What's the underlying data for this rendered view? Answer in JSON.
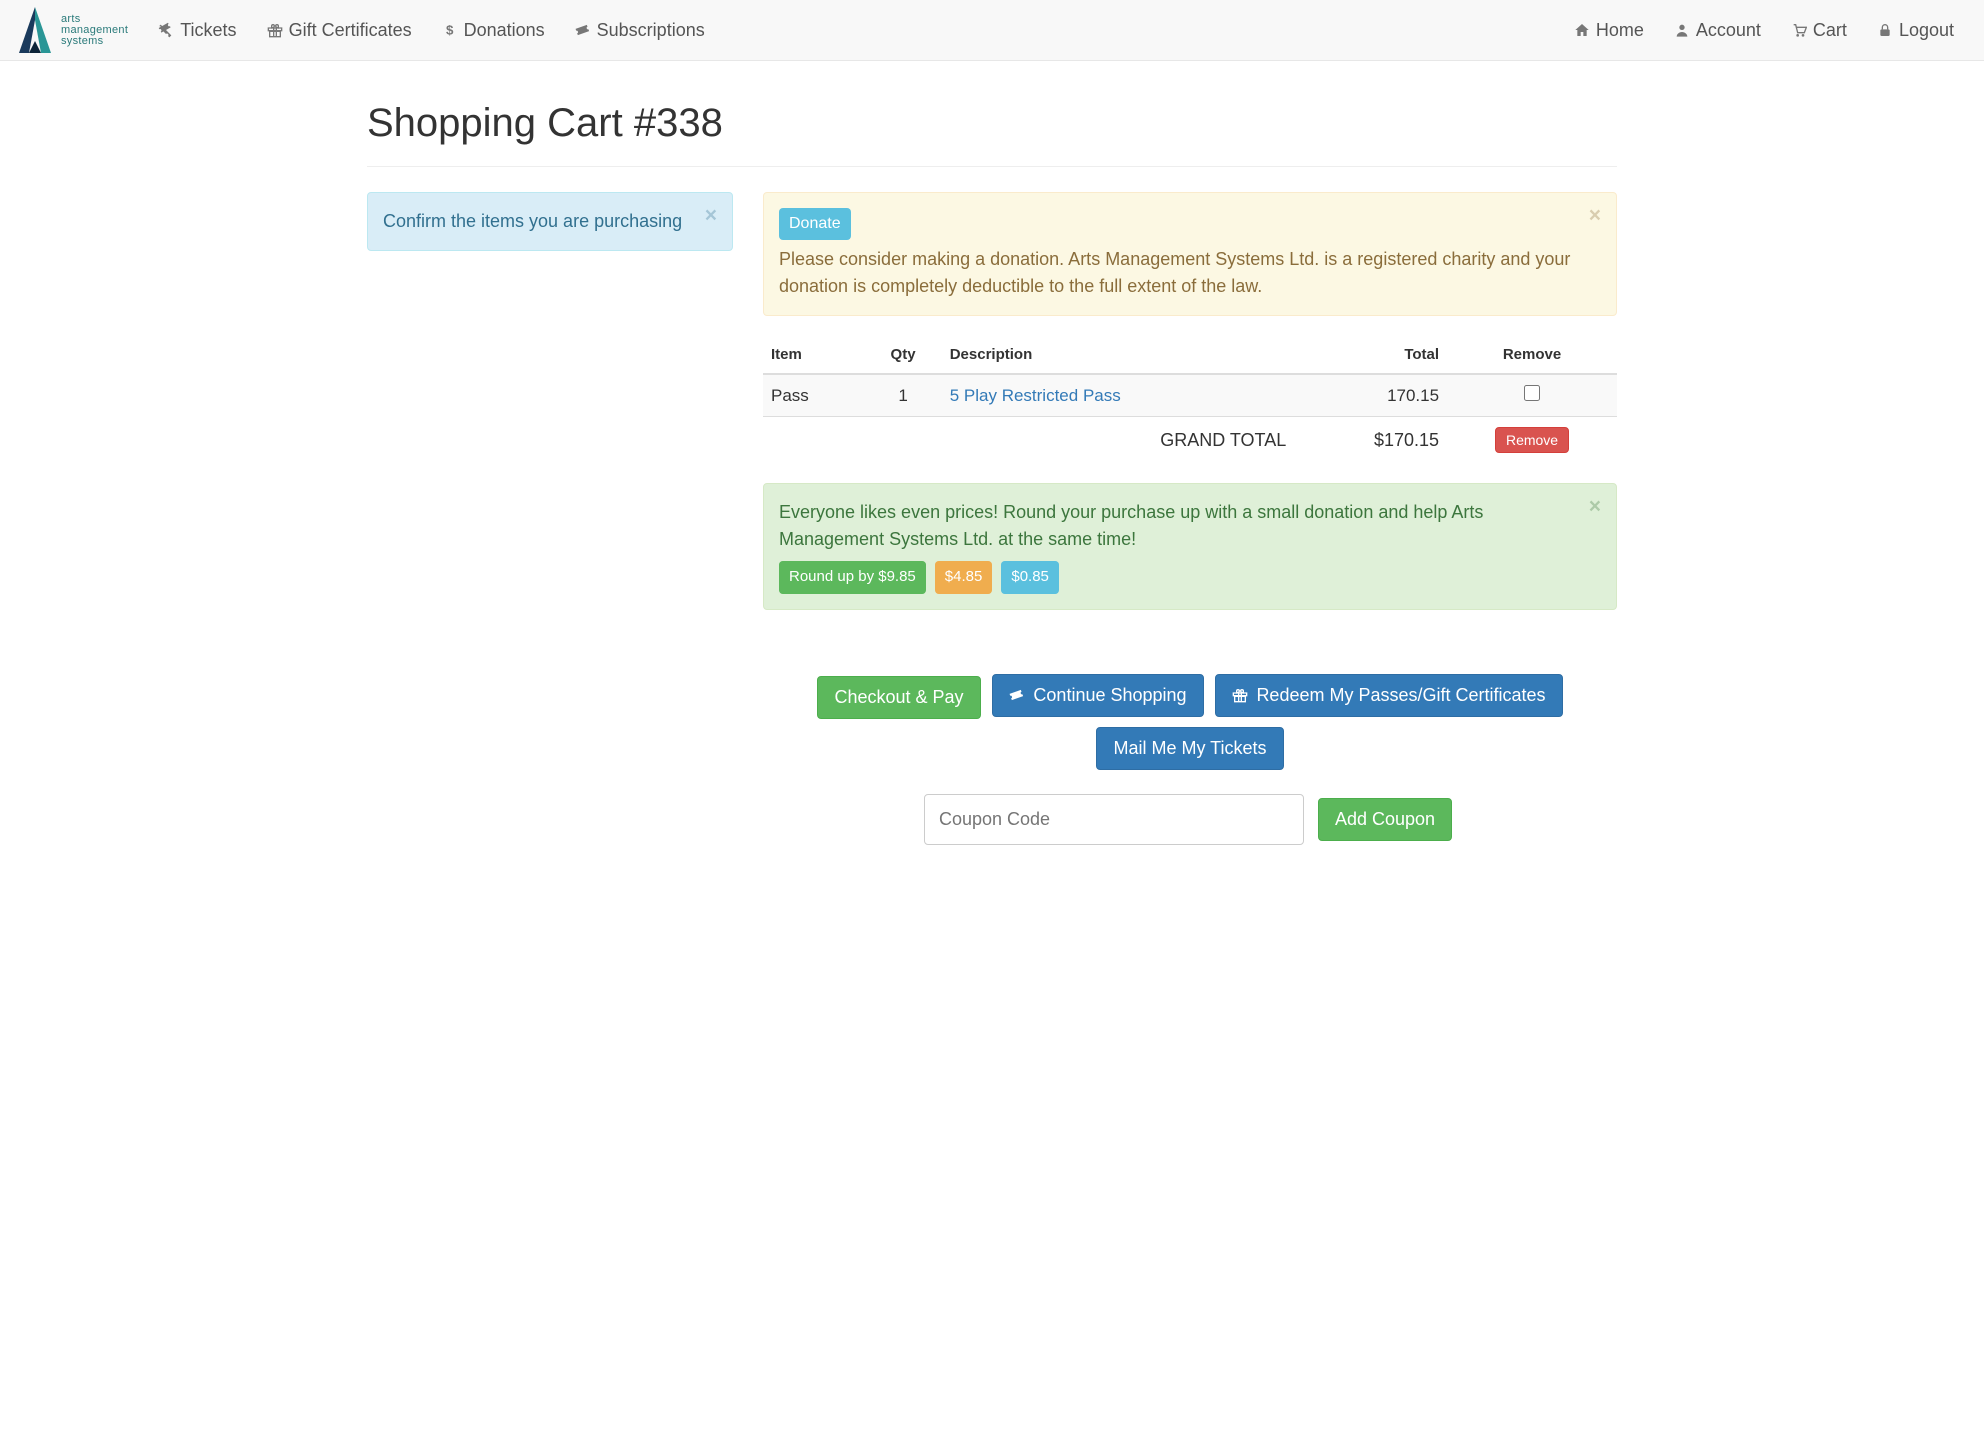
{
  "brand": {
    "l1": "arts",
    "l2": "management",
    "l3": "systems"
  },
  "nav": {
    "tickets": "Tickets",
    "gift": "Gift Certificates",
    "donations": "Donations",
    "subscriptions": "Subscriptions",
    "home": "Home",
    "account": "Account",
    "cart": "Cart",
    "logout": "Logout"
  },
  "page_title": "Shopping Cart #338",
  "confirm_alert": "Confirm the items you are purchasing",
  "donate": {
    "button": "Donate",
    "text": "Please consider making a donation. Arts Management Systems Ltd. is a registered charity and your donation is completely deductible to the full extent of the law."
  },
  "table": {
    "headers": {
      "item": "Item",
      "qty": "Qty",
      "desc": "Description",
      "total": "Total",
      "remove": "Remove"
    },
    "rows": [
      {
        "item": "Pass",
        "qty": "1",
        "desc": "5 Play Restricted Pass",
        "total": "170.15"
      }
    ],
    "grand_label": "GRAND TOTAL",
    "grand_total": "$170.15",
    "remove_btn": "Remove"
  },
  "roundup": {
    "text": "Everyone likes even prices!   Round your purchase up with a small donation and help Arts Management Systems Ltd. at the same time!",
    "b1": "Round up by $9.85",
    "b2": "$4.85",
    "b3": "$0.85"
  },
  "actions": {
    "checkout": "Checkout & Pay",
    "continue": "Continue Shopping",
    "redeem": "Redeem My Passes/Gift Certificates",
    "mail": "Mail Me My Tickets",
    "coupon_placeholder": "Coupon Code",
    "add_coupon": "Add Coupon"
  }
}
